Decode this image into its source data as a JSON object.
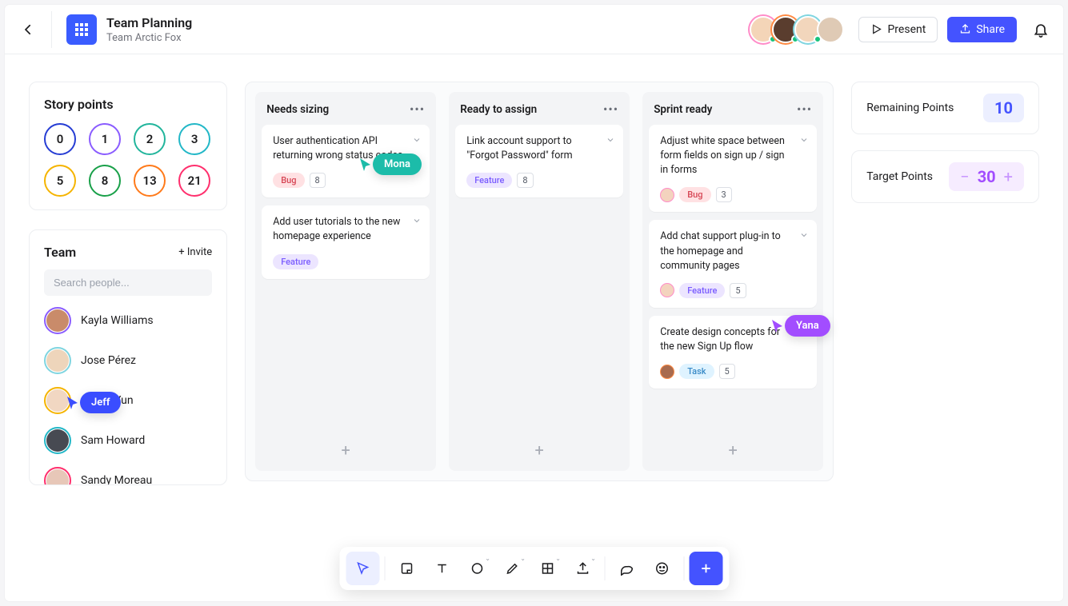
{
  "header": {
    "title": "Team Planning",
    "subtitle": "Team Arctic Fox",
    "present": "Present",
    "share": "Share",
    "avatars": [
      {
        "ring": "#ff8cc8",
        "fill": "#f4d5b8",
        "online": true
      },
      {
        "ring": "#ff8a43",
        "fill": "#5a3d2e",
        "online": true
      },
      {
        "ring": "#7fd5e0",
        "fill": "#f2d6bc",
        "online": true
      },
      {
        "ring": null,
        "fill": "#dfcab5",
        "online": false
      }
    ]
  },
  "story_points": {
    "title": "Story points",
    "values": [
      "0",
      "1",
      "2",
      "3",
      "5",
      "8",
      "13",
      "21"
    ],
    "colors": [
      "#263dd4",
      "#8a5cff",
      "#22b59c",
      "#22b7c7",
      "#f5b400",
      "#19a049",
      "#ff7a1a",
      "#ff2f6d"
    ]
  },
  "team": {
    "title": "Team",
    "invite": "+ Invite",
    "search_placeholder": "Search people...",
    "people": [
      {
        "name": "Kayla Williams",
        "ring": "#8a5cff",
        "fill": "#c98b6a"
      },
      {
        "name": "Jose Pérez",
        "ring": "#7fd5e0",
        "fill": "#eed5bb"
      },
      {
        "name": "Aileen Yun",
        "ring": "#f5b400",
        "fill": "#f1d7c2"
      },
      {
        "name": "Sam Howard",
        "ring": "#22b7c7",
        "fill": "#474a52"
      },
      {
        "name": "Sandy Moreau",
        "ring": "#ff2f6d",
        "fill": "#e7c7b8"
      }
    ]
  },
  "columns": [
    {
      "title": "Needs sizing",
      "cards": [
        {
          "text": "User authentication API returning wrong status codes",
          "tag": "Bug",
          "tag_class": "tag-bug",
          "points": "8",
          "avatar": null
        },
        {
          "text": "Add user tutorials to the new homepage experience",
          "tag": "Feature",
          "tag_class": "tag-feature",
          "points": null,
          "avatar": null
        }
      ]
    },
    {
      "title": "Ready to assign",
      "cards": [
        {
          "text": "Link account support to \"Forgot Password\" form",
          "tag": "Feature",
          "tag_class": "tag-feature",
          "points": "8",
          "avatar": null
        }
      ]
    },
    {
      "title": "Sprint ready",
      "cards": [
        {
          "text": "Adjust white space between form fields on sign up / sign in forms",
          "tag": "Bug",
          "tag_class": "tag-bug",
          "points": "3",
          "avatar": {
            "ring": "#ff8cc8",
            "fill": "#f3d3be"
          }
        },
        {
          "text": "Add chat support plug-in to the homepage and community pages",
          "tag": "Feature",
          "tag_class": "tag-feature",
          "points": "5",
          "avatar": {
            "ring": "#ff8cc8",
            "fill": "#f3d3be"
          }
        },
        {
          "text": "Create design concepts for the new Sign Up flow",
          "tag": "Task",
          "tag_class": "tag-task",
          "points": "5",
          "avatar": {
            "ring": "#ff8a43",
            "fill": "#a86b4f"
          }
        }
      ]
    }
  ],
  "metrics": {
    "remaining_label": "Remaining Points",
    "remaining_value": "10",
    "target_label": "Target Points",
    "target_value": "30"
  },
  "cursors": {
    "mona": {
      "label": "Mona",
      "color": "#1cbca9"
    },
    "yana": {
      "label": "Yana",
      "color": "#a24dff"
    },
    "jeff": {
      "label": "Jeff",
      "color": "#3a4dff"
    }
  },
  "toolbar": {
    "tools": [
      "pointer",
      "sticky",
      "text",
      "shape",
      "pencil",
      "table",
      "upload",
      "comment",
      "sticker",
      "plus"
    ]
  }
}
